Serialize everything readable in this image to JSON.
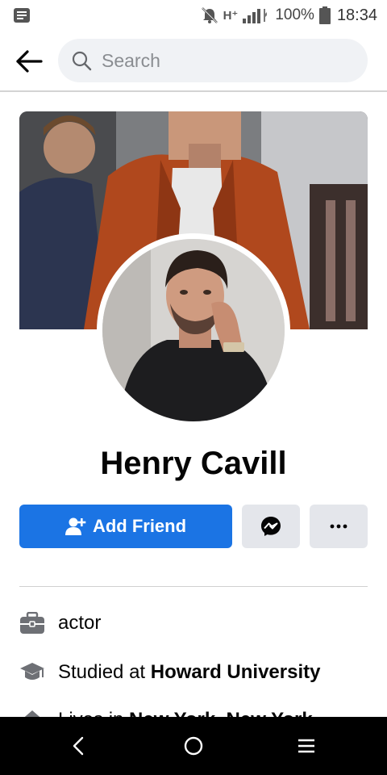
{
  "status_bar": {
    "network": "H⁺",
    "battery": "100%",
    "time": "18:34"
  },
  "header": {
    "search_placeholder": "Search"
  },
  "profile": {
    "name": "Henry Cavill"
  },
  "actions": {
    "add_friend_label": "Add Friend"
  },
  "intro": {
    "occupation": "actor",
    "education_prefix": "Studied at ",
    "education_school": "Howard University",
    "lives_prefix": "Lives in ",
    "lives_place": "New York, New York"
  },
  "colors": {
    "accent": "#1b74e4",
    "button_gray": "#e4e6eb"
  }
}
